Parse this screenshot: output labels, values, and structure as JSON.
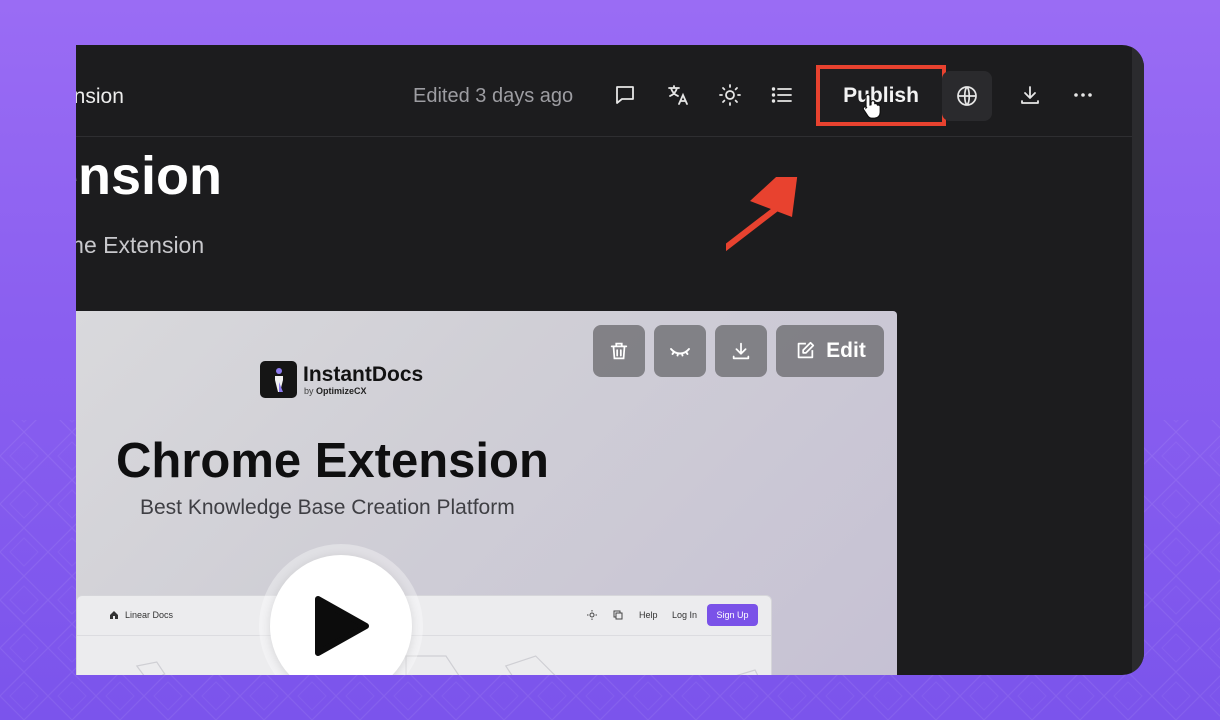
{
  "header": {
    "doc_title_truncated": "ension",
    "edited_status": "Edited 3 days ago",
    "publish_label": "Publish"
  },
  "page": {
    "heading_truncated": "ension",
    "subtitle_truncated": "ome Extension"
  },
  "media": {
    "edit_label": "Edit",
    "logo_name": "InstantDocs",
    "logo_by_prefix": "by",
    "logo_by_brand": "OptimizeCX",
    "hero_title": "Chrome Extension",
    "hero_subtitle": "Best Knowledge Base Creation Platform",
    "mini_site": {
      "brand": "Linear Docs",
      "help": "Help",
      "login": "Log In",
      "signup": "Sign Up"
    }
  },
  "icons": [
    "comment-icon",
    "translate-icon",
    "theme-sun-icon",
    "outline-list-icon",
    "globe-icon",
    "download-icon",
    "more-icon",
    "trash-icon",
    "hide-eye-icon",
    "edit-pencil-icon",
    "play-icon",
    "pointer-cursor-icon",
    "annotation-arrow"
  ],
  "colors": {
    "background_purple": "#8a5ff0",
    "editor_dark": "#1c1c1e",
    "highlight_red": "#e8422f",
    "accent_purple": "#7a52e8"
  }
}
